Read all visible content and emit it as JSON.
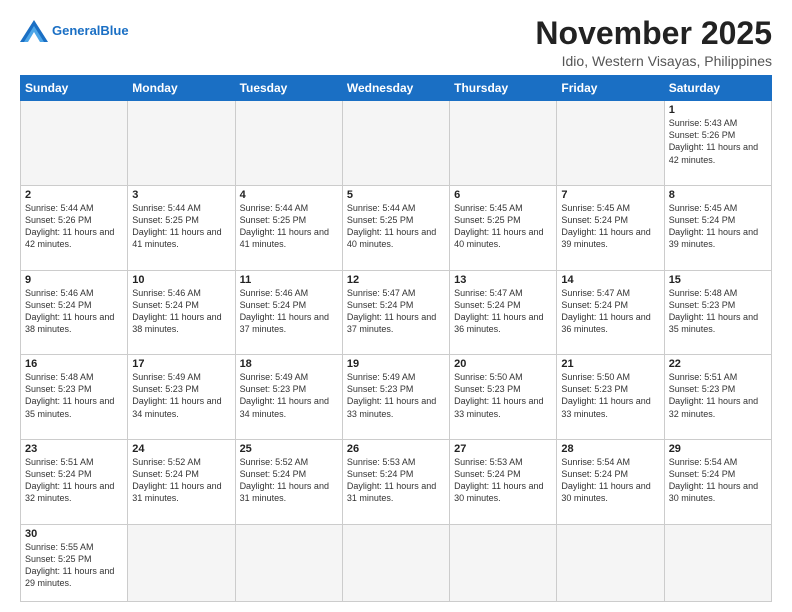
{
  "header": {
    "logo_general": "General",
    "logo_blue": "Blue",
    "month_title": "November 2025",
    "location": "Idio, Western Visayas, Philippines"
  },
  "weekdays": [
    "Sunday",
    "Monday",
    "Tuesday",
    "Wednesday",
    "Thursday",
    "Friday",
    "Saturday"
  ],
  "weeks": [
    [
      {
        "day": "",
        "info": ""
      },
      {
        "day": "",
        "info": ""
      },
      {
        "day": "",
        "info": ""
      },
      {
        "day": "",
        "info": ""
      },
      {
        "day": "",
        "info": ""
      },
      {
        "day": "",
        "info": ""
      },
      {
        "day": "1",
        "info": "Sunrise: 5:43 AM\nSunset: 5:26 PM\nDaylight: 11 hours\nand 42 minutes."
      }
    ],
    [
      {
        "day": "2",
        "info": "Sunrise: 5:44 AM\nSunset: 5:26 PM\nDaylight: 11 hours\nand 42 minutes."
      },
      {
        "day": "3",
        "info": "Sunrise: 5:44 AM\nSunset: 5:25 PM\nDaylight: 11 hours\nand 41 minutes."
      },
      {
        "day": "4",
        "info": "Sunrise: 5:44 AM\nSunset: 5:25 PM\nDaylight: 11 hours\nand 41 minutes."
      },
      {
        "day": "5",
        "info": "Sunrise: 5:44 AM\nSunset: 5:25 PM\nDaylight: 11 hours\nand 40 minutes."
      },
      {
        "day": "6",
        "info": "Sunrise: 5:45 AM\nSunset: 5:25 PM\nDaylight: 11 hours\nand 40 minutes."
      },
      {
        "day": "7",
        "info": "Sunrise: 5:45 AM\nSunset: 5:24 PM\nDaylight: 11 hours\nand 39 minutes."
      },
      {
        "day": "8",
        "info": "Sunrise: 5:45 AM\nSunset: 5:24 PM\nDaylight: 11 hours\nand 39 minutes."
      }
    ],
    [
      {
        "day": "9",
        "info": "Sunrise: 5:46 AM\nSunset: 5:24 PM\nDaylight: 11 hours\nand 38 minutes."
      },
      {
        "day": "10",
        "info": "Sunrise: 5:46 AM\nSunset: 5:24 PM\nDaylight: 11 hours\nand 38 minutes."
      },
      {
        "day": "11",
        "info": "Sunrise: 5:46 AM\nSunset: 5:24 PM\nDaylight: 11 hours\nand 37 minutes."
      },
      {
        "day": "12",
        "info": "Sunrise: 5:47 AM\nSunset: 5:24 PM\nDaylight: 11 hours\nand 37 minutes."
      },
      {
        "day": "13",
        "info": "Sunrise: 5:47 AM\nSunset: 5:24 PM\nDaylight: 11 hours\nand 36 minutes."
      },
      {
        "day": "14",
        "info": "Sunrise: 5:47 AM\nSunset: 5:24 PM\nDaylight: 11 hours\nand 36 minutes."
      },
      {
        "day": "15",
        "info": "Sunrise: 5:48 AM\nSunset: 5:23 PM\nDaylight: 11 hours\nand 35 minutes."
      }
    ],
    [
      {
        "day": "16",
        "info": "Sunrise: 5:48 AM\nSunset: 5:23 PM\nDaylight: 11 hours\nand 35 minutes."
      },
      {
        "day": "17",
        "info": "Sunrise: 5:49 AM\nSunset: 5:23 PM\nDaylight: 11 hours\nand 34 minutes."
      },
      {
        "day": "18",
        "info": "Sunrise: 5:49 AM\nSunset: 5:23 PM\nDaylight: 11 hours\nand 34 minutes."
      },
      {
        "day": "19",
        "info": "Sunrise: 5:49 AM\nSunset: 5:23 PM\nDaylight: 11 hours\nand 33 minutes."
      },
      {
        "day": "20",
        "info": "Sunrise: 5:50 AM\nSunset: 5:23 PM\nDaylight: 11 hours\nand 33 minutes."
      },
      {
        "day": "21",
        "info": "Sunrise: 5:50 AM\nSunset: 5:23 PM\nDaylight: 11 hours\nand 33 minutes."
      },
      {
        "day": "22",
        "info": "Sunrise: 5:51 AM\nSunset: 5:23 PM\nDaylight: 11 hours\nand 32 minutes."
      }
    ],
    [
      {
        "day": "23",
        "info": "Sunrise: 5:51 AM\nSunset: 5:24 PM\nDaylight: 11 hours\nand 32 minutes."
      },
      {
        "day": "24",
        "info": "Sunrise: 5:52 AM\nSunset: 5:24 PM\nDaylight: 11 hours\nand 31 minutes."
      },
      {
        "day": "25",
        "info": "Sunrise: 5:52 AM\nSunset: 5:24 PM\nDaylight: 11 hours\nand 31 minutes."
      },
      {
        "day": "26",
        "info": "Sunrise: 5:53 AM\nSunset: 5:24 PM\nDaylight: 11 hours\nand 31 minutes."
      },
      {
        "day": "27",
        "info": "Sunrise: 5:53 AM\nSunset: 5:24 PM\nDaylight: 11 hours\nand 30 minutes."
      },
      {
        "day": "28",
        "info": "Sunrise: 5:54 AM\nSunset: 5:24 PM\nDaylight: 11 hours\nand 30 minutes."
      },
      {
        "day": "29",
        "info": "Sunrise: 5:54 AM\nSunset: 5:24 PM\nDaylight: 11 hours\nand 30 minutes."
      }
    ],
    [
      {
        "day": "30",
        "info": "Sunrise: 5:55 AM\nSunset: 5:25 PM\nDaylight: 11 hours\nand 29 minutes."
      },
      {
        "day": "",
        "info": ""
      },
      {
        "day": "",
        "info": ""
      },
      {
        "day": "",
        "info": ""
      },
      {
        "day": "",
        "info": ""
      },
      {
        "day": "",
        "info": ""
      },
      {
        "day": "",
        "info": ""
      }
    ]
  ]
}
